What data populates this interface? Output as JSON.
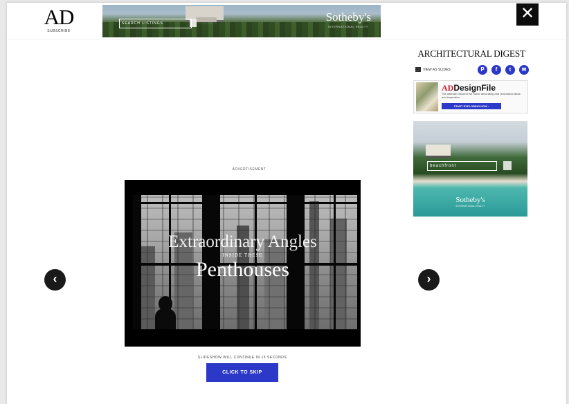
{
  "header": {
    "logo": "AD",
    "logo_sub": "SUBSCRIBE",
    "top_ad": {
      "search_placeholder": "SEARCH LISTINGS",
      "brand": "Sotheby's",
      "brand_sub": "INTERNATIONAL REALTY"
    },
    "close_label": "✕"
  },
  "sidebar": {
    "masthead": "ARCHITECTURAL DIGEST",
    "view_slides_label": "VIEW AS SLIDES",
    "social_icons": [
      "pinterest-icon",
      "facebook-icon",
      "twitter-icon",
      "email-icon"
    ],
    "design_file_ad": {
      "logo_prefix": "AD",
      "logo_suffix": "DesignFile",
      "tagline": "The ultimate resource for home decorating and renovation ideas and inspiration",
      "cta": "START EXPLORING NOW ›"
    },
    "beach_ad": {
      "search_placeholder": "beachfront",
      "brand": "Sotheby's",
      "brand_sub": "INTERNATIONAL REALTY"
    }
  },
  "main": {
    "ad_label": "ADVERTISEMENT",
    "video": {
      "title_line1": "Extraordinary Angles",
      "title_line2": "INSIDE THESE",
      "title_line3": "Penthouses"
    },
    "prev_label": "‹",
    "next_label": "›",
    "countdown_text": "SLIDESHOW WILL CONTINUE IN 15 SECONDS",
    "skip_label": "CLICK TO SKIP"
  },
  "colors": {
    "accent": "#2b38c8",
    "close_bg": "#0c0c0c"
  }
}
